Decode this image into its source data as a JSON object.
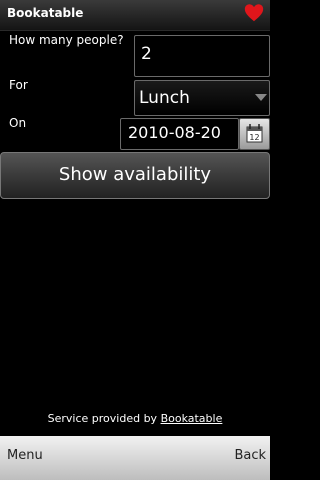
{
  "app": {
    "title": "Bookatable"
  },
  "form": {
    "people_label": "How many people?",
    "people_value": "2",
    "for_label": "For",
    "meal_value": "Lunch",
    "on_label": "On",
    "date_value": "2010-08-20",
    "calendar_day": "12"
  },
  "actions": {
    "show_availability": "Show availability"
  },
  "footer": {
    "service_prefix": "Service provided by ",
    "service_link": "Bookatable"
  },
  "softkeys": {
    "left": "Menu",
    "right": "Back"
  },
  "icons": {
    "title_right": "heart-icon",
    "calendar": "calendar-icon",
    "dropdown": "chevron-down-icon"
  },
  "colors": {
    "heart": "#e0161b",
    "background": "#000000"
  }
}
